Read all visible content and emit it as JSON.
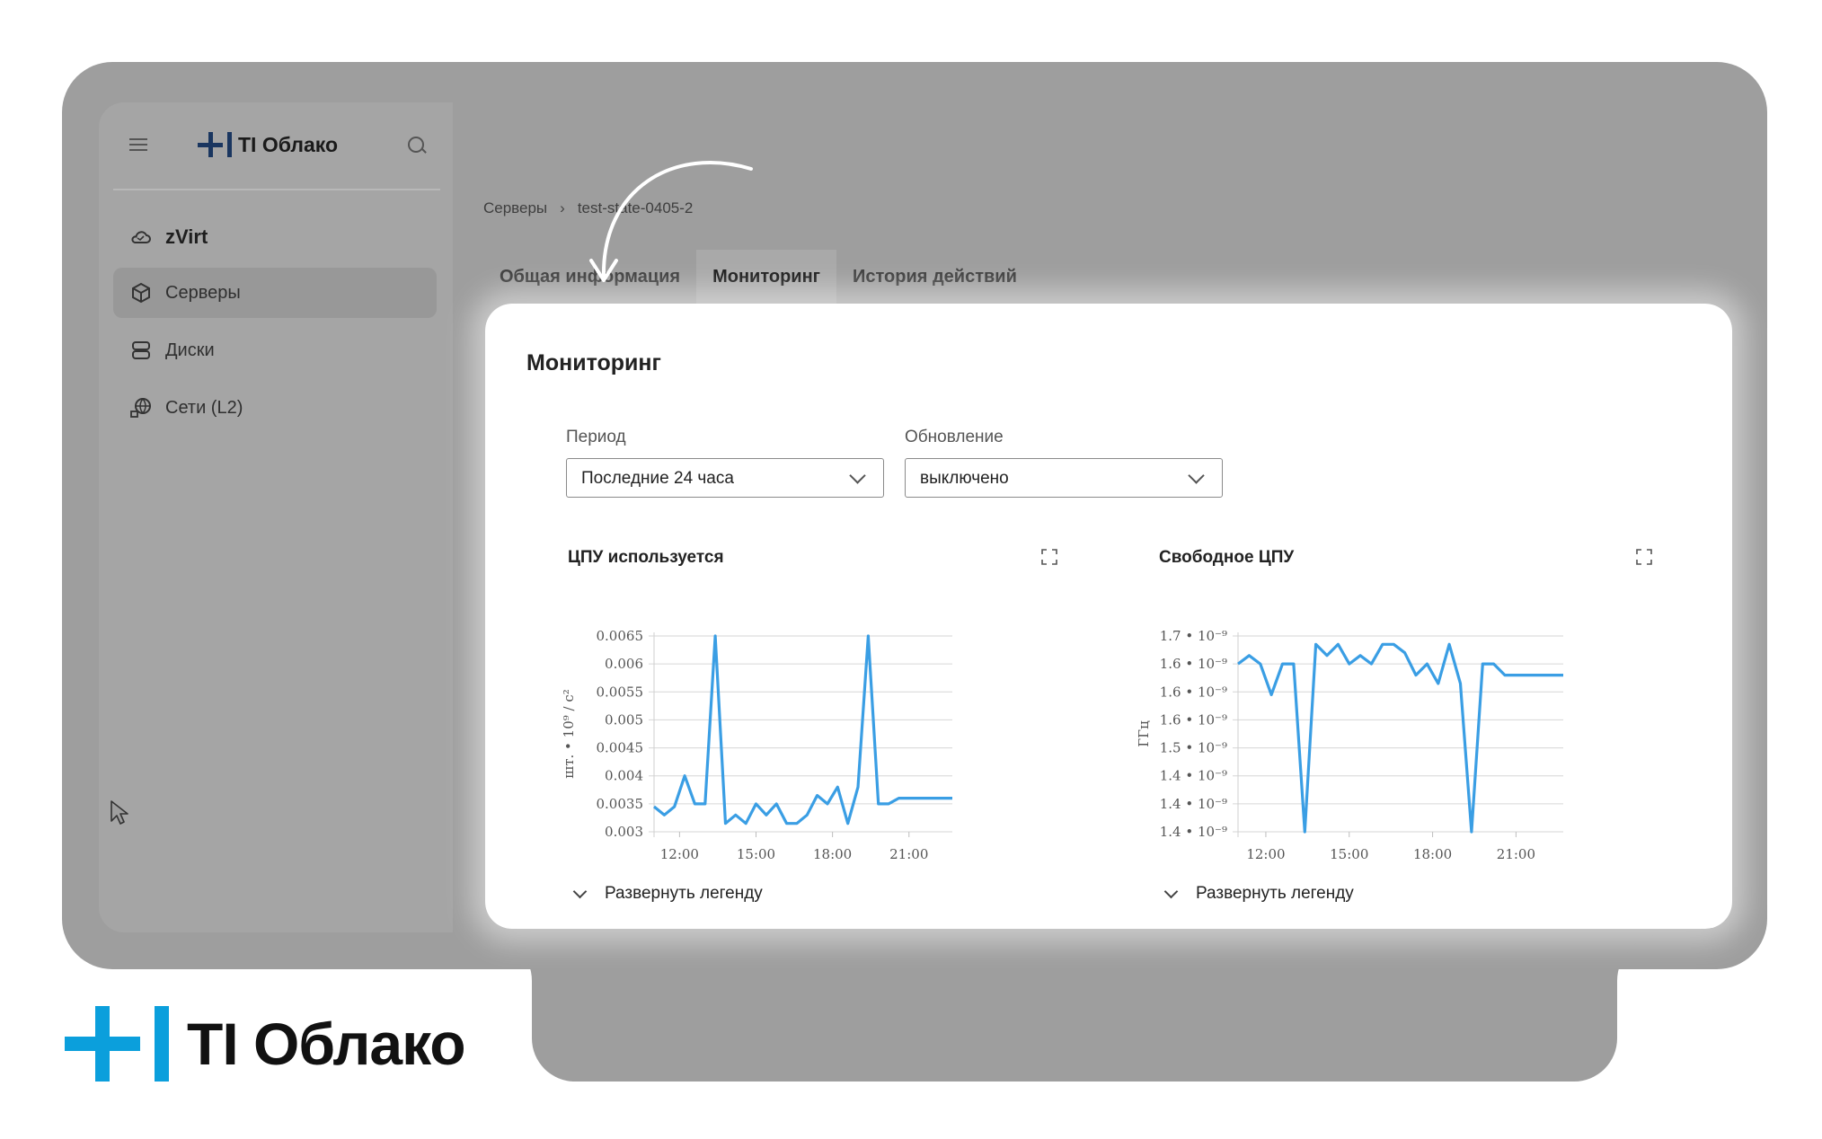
{
  "app": {
    "name": "TI Облако"
  },
  "sidebar": {
    "items": [
      {
        "label": "zVirt",
        "icon": "cloud-icon"
      },
      {
        "label": "Серверы",
        "icon": "cube-icon"
      },
      {
        "label": "Диски",
        "icon": "database-icon"
      },
      {
        "label": "Сети (L2)",
        "icon": "network-icon"
      }
    ],
    "active": "Серверы"
  },
  "breadcrumb": {
    "items": [
      "Серверы",
      "test-state-0405-2"
    ]
  },
  "tabs": [
    {
      "label": "Общая информация"
    },
    {
      "label": "Мониторинг"
    },
    {
      "label": "История действий"
    }
  ],
  "active_tab": "Мониторинг",
  "panel": {
    "title": "Мониторинг",
    "period": {
      "label": "Период",
      "value": "Последние 24 часа"
    },
    "refresh": {
      "label": "Обновление",
      "value": "выключено"
    },
    "legend_toggle": "Развернуть легенду"
  },
  "colors": {
    "line": "#3a9ee4",
    "brand": "#0b9fdc",
    "brand_dark": "#1a3660"
  },
  "chart_data": [
    {
      "type": "line",
      "title": "ЦПУ используется",
      "ylabel": "шт. • 10⁹ / с²",
      "xticks": [
        "12:00",
        "15:00",
        "18:00",
        "21:00"
      ],
      "yticks": [
        "0.003",
        "0.0035",
        "0.004",
        "0.0045",
        "0.005",
        "0.0055",
        "0.006",
        "0.0065"
      ],
      "ylim": [
        0.003,
        0.0065
      ],
      "xlim": [
        11.0,
        22.7
      ],
      "grid": true,
      "series": [
        {
          "x": [
            11.0,
            11.4,
            11.8,
            12.2,
            12.6,
            13.0,
            13.4,
            13.8,
            14.2,
            14.6,
            15.0,
            15.4,
            15.8,
            16.2,
            16.6,
            17.0,
            17.4,
            17.8,
            18.2,
            18.6,
            19.0,
            19.4,
            19.8,
            20.2,
            20.6,
            21.0,
            21.4,
            21.8,
            22.2,
            22.7
          ],
          "y": [
            0.00345,
            0.0033,
            0.00345,
            0.004,
            0.0035,
            0.0035,
            0.0065,
            0.00315,
            0.0033,
            0.00315,
            0.0035,
            0.0033,
            0.0035,
            0.00315,
            0.00315,
            0.0033,
            0.00365,
            0.0035,
            0.0038,
            0.00315,
            0.0038,
            0.0065,
            0.0035,
            0.0035,
            0.0036,
            0.0036,
            0.0036,
            0.0036,
            0.0036,
            0.0036
          ]
        }
      ]
    },
    {
      "type": "line",
      "title": "Свободное ЦПУ",
      "ylabel": "ГГц",
      "xticks": [
        "12:00",
        "15:00",
        "18:00",
        "21:00"
      ],
      "yticks": [
        "1.4 • 10⁻⁹",
        "1.4 • 10⁻⁹",
        "1.4 • 10⁻⁹",
        "1.5 • 10⁻⁹",
        "1.6 • 10⁻⁹",
        "1.6 • 10⁻⁹",
        "1.6 • 10⁻⁹",
        "1.7 • 10⁻⁹"
      ],
      "ylim": [
        0,
        7
      ],
      "xlim": [
        11.0,
        22.7
      ],
      "grid": true,
      "series": [
        {
          "x": [
            11.0,
            11.4,
            11.8,
            12.2,
            12.6,
            13.0,
            13.4,
            13.8,
            14.2,
            14.6,
            15.0,
            15.4,
            15.8,
            16.2,
            16.6,
            17.0,
            17.4,
            17.8,
            18.2,
            18.6,
            19.0,
            19.4,
            19.8,
            20.2,
            20.6,
            21.0,
            21.4,
            21.8,
            22.2,
            22.7
          ],
          "y": [
            6.0,
            6.3,
            6.0,
            4.9,
            6.0,
            6.0,
            0.0,
            6.7,
            6.3,
            6.7,
            6.0,
            6.3,
            6.0,
            6.7,
            6.7,
            6.4,
            5.6,
            6.0,
            5.3,
            6.7,
            5.3,
            0.0,
            6.0,
            6.0,
            5.6,
            5.6,
            5.6,
            5.6,
            5.6,
            5.6
          ]
        }
      ]
    }
  ]
}
